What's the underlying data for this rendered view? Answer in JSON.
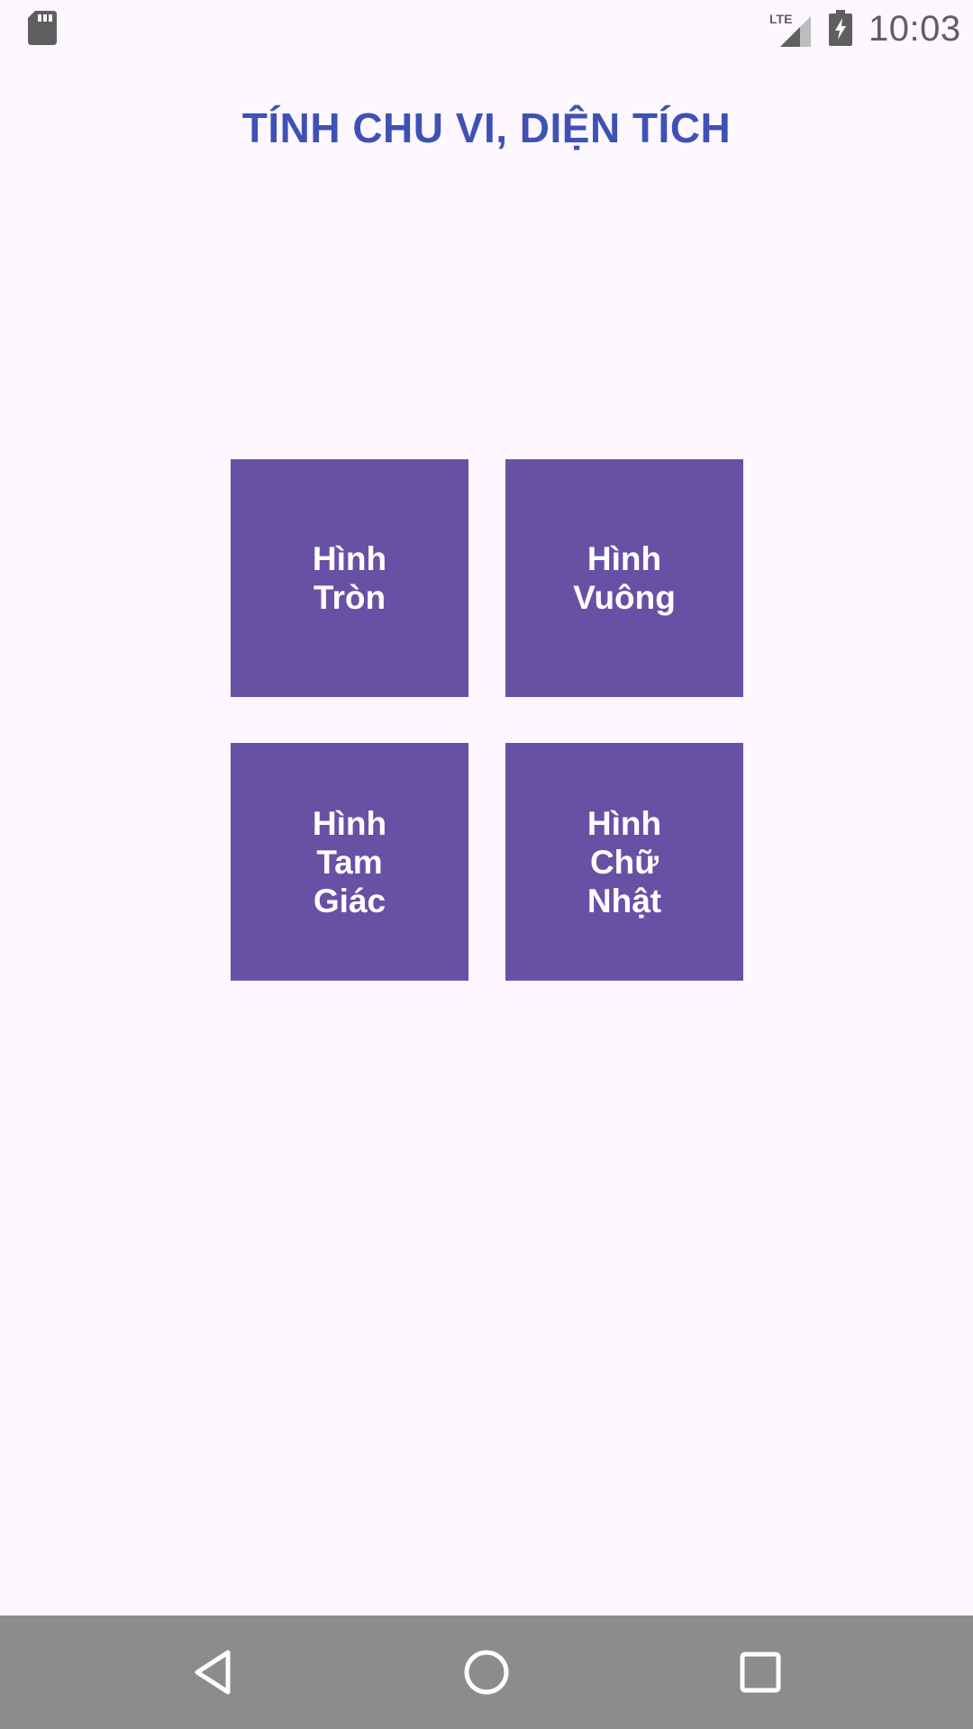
{
  "status_bar": {
    "time": "10:03",
    "network_label": "LTE",
    "icons": [
      "sd-card-icon",
      "lte-signal-icon",
      "battery-charging-icon"
    ]
  },
  "title": "TÍNH CHU VI, DIỆN TÍCH",
  "shapes": [
    {
      "label": "Hình Tròn"
    },
    {
      "label": "Hình Vuông"
    },
    {
      "label": "Hình Tam Giác"
    },
    {
      "label": "Hình Chữ Nhật"
    }
  ],
  "nav_bar": {
    "icons": [
      "back-icon",
      "home-icon",
      "recents-icon"
    ]
  },
  "colors": {
    "background": "#FDF7FF",
    "title": "#3F51B5",
    "button": "#6851A4",
    "button_text": "#FFFFFF",
    "nav_bar": "#8E8B8F"
  }
}
